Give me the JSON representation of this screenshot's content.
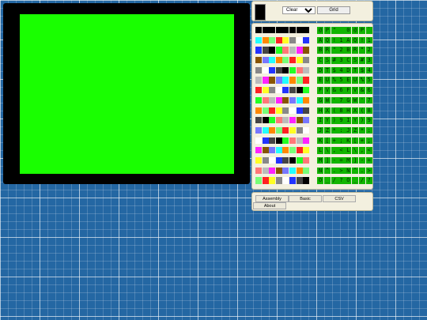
{
  "toolbar": {
    "mode_value": "Clear",
    "mode_options": [
      "Clear"
    ],
    "grid_label": "Grid"
  },
  "colors": [
    "#000000",
    "#ffffff",
    "#ff2222",
    "#22ffff",
    "#ff22ff",
    "#22ff22",
    "#2233ff",
    "#ffff22",
    "#ff8800",
    "#885500",
    "#ff7777",
    "#444444",
    "#888888",
    "#77ff77",
    "#7777ff",
    "#bbbbbb"
  ],
  "char_rows": [
    "@P\" 0@P`0",
    "AQ!1AQ!1",
    "BR\"2BR\"2",
    "CS#3CS#3",
    "DT$4DT$4",
    "EU%5EU%5",
    "FV&6FV&6",
    "GW'7GW'7",
    "HX(8HX(8",
    "IY)9IY)9",
    "JZ*:JZ*:",
    "K[+;K[+;",
    "L\\,<L\\,<",
    "M]-=M]-=",
    "N^.>N^.>",
    "O_/?O_/?"
  ],
  "buttons": {
    "assembly": "Assembly",
    "basic": "Basic",
    "csv": "CSV",
    "about": "About"
  }
}
